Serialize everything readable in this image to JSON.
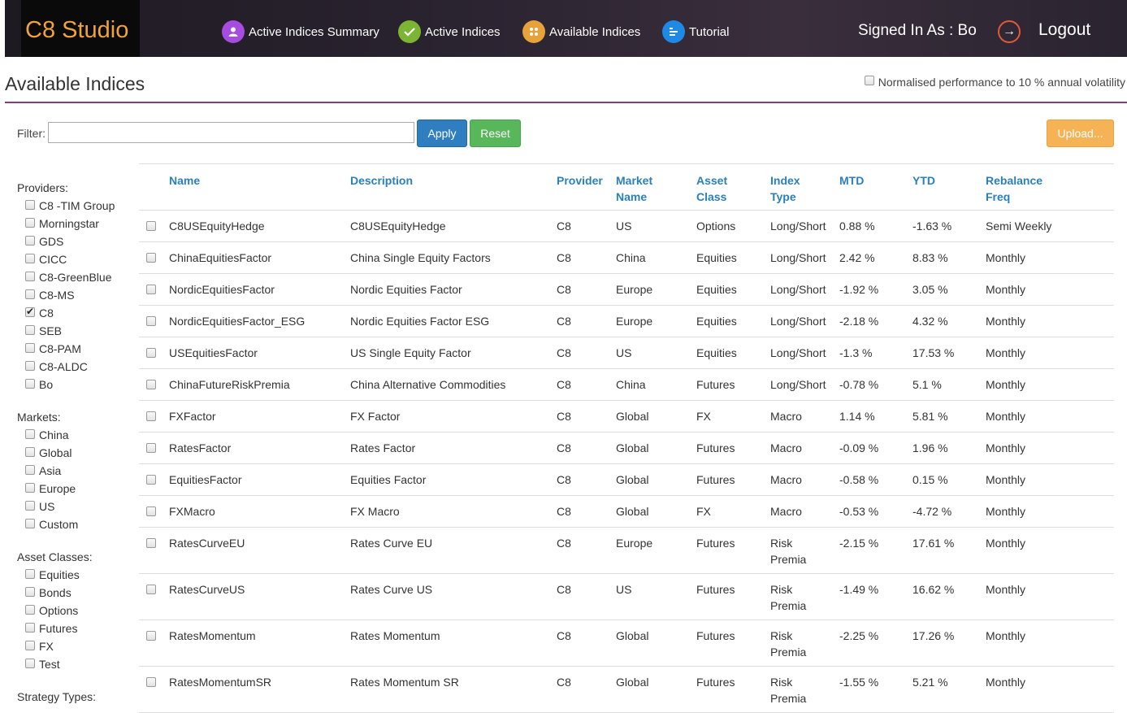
{
  "header": {
    "logo": "C8 Studio",
    "nav": [
      {
        "label": "Active Indices Summary",
        "icon": "user-icon",
        "color": "#a74ce0"
      },
      {
        "label": "Active Indices",
        "icon": "check-icon",
        "color": "#7cb534"
      },
      {
        "label": "Available Indices",
        "icon": "grid-dots-icon",
        "color": "#e8a23a"
      },
      {
        "label": "Tutorial",
        "icon": "list-icon",
        "color": "#1e8ae6"
      }
    ],
    "signed_in": "Signed In As : Bo",
    "logout": "Logout"
  },
  "page": {
    "title": "Available Indices",
    "normalise_label": "Normalised performance to 10 % annual volatility",
    "normalise_checked": false
  },
  "filter": {
    "label": "Filter:",
    "value": "",
    "apply": "Apply",
    "reset": "Reset",
    "upload": "Upload..."
  },
  "sidebar": {
    "providers_title": "Providers:",
    "providers": [
      {
        "label": "C8 -TIM Group",
        "checked": false
      },
      {
        "label": "Morningstar",
        "checked": false
      },
      {
        "label": "GDS",
        "checked": false
      },
      {
        "label": "CICC",
        "checked": false
      },
      {
        "label": "C8-GreenBlue",
        "checked": false
      },
      {
        "label": "C8-MS",
        "checked": false
      },
      {
        "label": "C8",
        "checked": true
      },
      {
        "label": "SEB",
        "checked": false
      },
      {
        "label": "C8-PAM",
        "checked": false
      },
      {
        "label": "C8-ALDC",
        "checked": false
      },
      {
        "label": "Bo",
        "checked": false
      }
    ],
    "markets_title": "Markets:",
    "markets": [
      {
        "label": "China",
        "checked": false
      },
      {
        "label": "Global",
        "checked": false
      },
      {
        "label": "Asia",
        "checked": false
      },
      {
        "label": "Europe",
        "checked": false
      },
      {
        "label": "US",
        "checked": false
      },
      {
        "label": "Custom",
        "checked": false
      }
    ],
    "asset_classes_title": "Asset Classes:",
    "asset_classes": [
      {
        "label": "Equities",
        "checked": false
      },
      {
        "label": "Bonds",
        "checked": false
      },
      {
        "label": "Options",
        "checked": false
      },
      {
        "label": "Futures",
        "checked": false
      },
      {
        "label": "FX",
        "checked": false
      },
      {
        "label": "Test",
        "checked": false
      }
    ],
    "strategy_types_title": "Strategy Types:"
  },
  "table": {
    "columns": [
      {
        "l1": "Name",
        "l2": ""
      },
      {
        "l1": "Description",
        "l2": ""
      },
      {
        "l1": "Provider",
        "l2": ""
      },
      {
        "l1": "Market",
        "l2": "Name"
      },
      {
        "l1": "Asset",
        "l2": "Class"
      },
      {
        "l1": "Index",
        "l2": "Type"
      },
      {
        "l1": "MTD",
        "l2": ""
      },
      {
        "l1": "YTD",
        "l2": ""
      },
      {
        "l1": "Rebalance",
        "l2": "Freq"
      }
    ],
    "rows": [
      {
        "name": "C8USEquityHedge",
        "description": "C8USEquityHedge",
        "provider": "C8",
        "market": "US",
        "asset_class": "Options",
        "type1": "Long/Short",
        "type2": "",
        "mtd": "0.88 %",
        "ytd": "-1.63 %",
        "freq": "Semi Weekly"
      },
      {
        "name": "ChinaEquitiesFactor",
        "description": "China Single Equity Factors",
        "provider": "C8",
        "market": "China",
        "asset_class": "Equities",
        "type1": "Long/Short",
        "type2": "",
        "mtd": "2.42 %",
        "ytd": "8.83 %",
        "freq": "Monthly"
      },
      {
        "name": "NordicEquitiesFactor",
        "description": "Nordic Equities Factor",
        "provider": "C8",
        "market": "Europe",
        "asset_class": "Equities",
        "type1": "Long/Short",
        "type2": "",
        "mtd": "-1.92 %",
        "ytd": "3.05 %",
        "freq": "Monthly"
      },
      {
        "name": "NordicEquitiesFactor_ESG",
        "description": "Nordic Equities Factor ESG",
        "provider": "C8",
        "market": "Europe",
        "asset_class": "Equities",
        "type1": "Long/Short",
        "type2": "",
        "mtd": "-2.18 %",
        "ytd": "4.32 %",
        "freq": "Monthly"
      },
      {
        "name": "USEquitiesFactor",
        "description": "US Single Equity Factor",
        "provider": "C8",
        "market": "US",
        "asset_class": "Equities",
        "type1": "Long/Short",
        "type2": "",
        "mtd": "-1.3 %",
        "ytd": "17.53 %",
        "freq": "Monthly"
      },
      {
        "name": "ChinaFutureRiskPremia",
        "description": "China Alternative Commodities",
        "provider": "C8",
        "market": "China",
        "asset_class": "Futures",
        "type1": "Long/Short",
        "type2": "",
        "mtd": "-0.78 %",
        "ytd": "5.1 %",
        "freq": "Monthly"
      },
      {
        "name": "FXFactor",
        "description": "FX Factor",
        "provider": "C8",
        "market": "Global",
        "asset_class": "FX",
        "type1": "Macro",
        "type2": "",
        "mtd": "1.14 %",
        "ytd": "5.81 %",
        "freq": "Monthly"
      },
      {
        "name": "RatesFactor",
        "description": "Rates Factor",
        "provider": "C8",
        "market": "Global",
        "asset_class": "Futures",
        "type1": "Macro",
        "type2": "",
        "mtd": "-0.09 %",
        "ytd": "1.96 %",
        "freq": "Monthly"
      },
      {
        "name": "EquitiesFactor",
        "description": "Equities Factor",
        "provider": "C8",
        "market": "Global",
        "asset_class": "Futures",
        "type1": "Macro",
        "type2": "",
        "mtd": "-0.58 %",
        "ytd": "0.15 %",
        "freq": "Monthly"
      },
      {
        "name": "FXMacro",
        "description": "FX Macro",
        "provider": "C8",
        "market": "Global",
        "asset_class": "FX",
        "type1": "Macro",
        "type2": "",
        "mtd": "-0.53 %",
        "ytd": "-4.72 %",
        "freq": "Monthly"
      },
      {
        "name": "RatesCurveEU",
        "description": "Rates Curve EU",
        "provider": "C8",
        "market": "Europe",
        "asset_class": "Futures",
        "type1": "Risk",
        "type2": "Premia",
        "mtd": "-2.15 %",
        "ytd": "17.61 %",
        "freq": "Monthly"
      },
      {
        "name": "RatesCurveUS",
        "description": "Rates Curve US",
        "provider": "C8",
        "market": "US",
        "asset_class": "Futures",
        "type1": "Risk",
        "type2": "Premia",
        "mtd": "-1.49 %",
        "ytd": "16.62 %",
        "freq": "Monthly"
      },
      {
        "name": "RatesMomentum",
        "description": "Rates Momentum",
        "provider": "C8",
        "market": "Global",
        "asset_class": "Futures",
        "type1": "Risk",
        "type2": "Premia",
        "mtd": "-2.25 %",
        "ytd": "17.26 %",
        "freq": "Monthly"
      },
      {
        "name": "RatesMomentumSR",
        "description": "Rates Momentum SR",
        "provider": "C8",
        "market": "Global",
        "asset_class": "Futures",
        "type1": "Risk",
        "type2": "Premia",
        "mtd": "-1.55 %",
        "ytd": "5.21 %",
        "freq": "Monthly"
      }
    ]
  }
}
